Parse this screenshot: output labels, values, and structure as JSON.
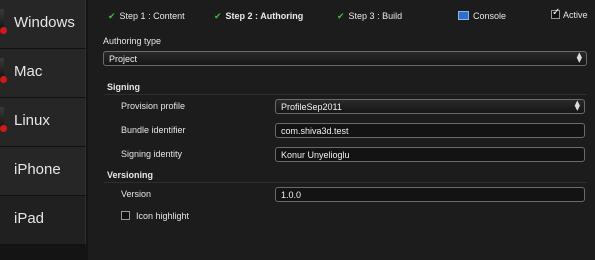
{
  "sidebar": {
    "items": [
      {
        "label": "Windows"
      },
      {
        "label": "Mac"
      },
      {
        "label": "Linux"
      },
      {
        "label": "iPhone"
      },
      {
        "label": "iPad"
      }
    ]
  },
  "steps": [
    {
      "label": "Step 1 : Content",
      "done": true
    },
    {
      "label": "Step 2 : Authoring",
      "done": true,
      "current": true
    },
    {
      "label": "Step 3 : Build",
      "done": true
    }
  ],
  "topbar": {
    "console_label": "Console",
    "active_label": "Active",
    "active_checked": true
  },
  "authoring": {
    "type_label": "Authoring type",
    "type_value": "Project"
  },
  "signing": {
    "section_label": "Signing",
    "provision_label": "Provision profile",
    "provision_value": "ProfileSep2011",
    "bundle_label": "Bundle identifier",
    "bundle_value": "com.shiva3d.test",
    "identity_label": "Signing identity",
    "identity_value": "Konur Unyelioglu"
  },
  "versioning": {
    "section_label": "Versioning",
    "version_label": "Version",
    "version_value": "1.0.0",
    "icon_highlight_label": "Icon highlight",
    "icon_highlight_checked": false
  },
  "colors": {
    "check_green": "#36c13a",
    "platform_red": "#d11919",
    "console_blue": "#2e6fc9"
  }
}
